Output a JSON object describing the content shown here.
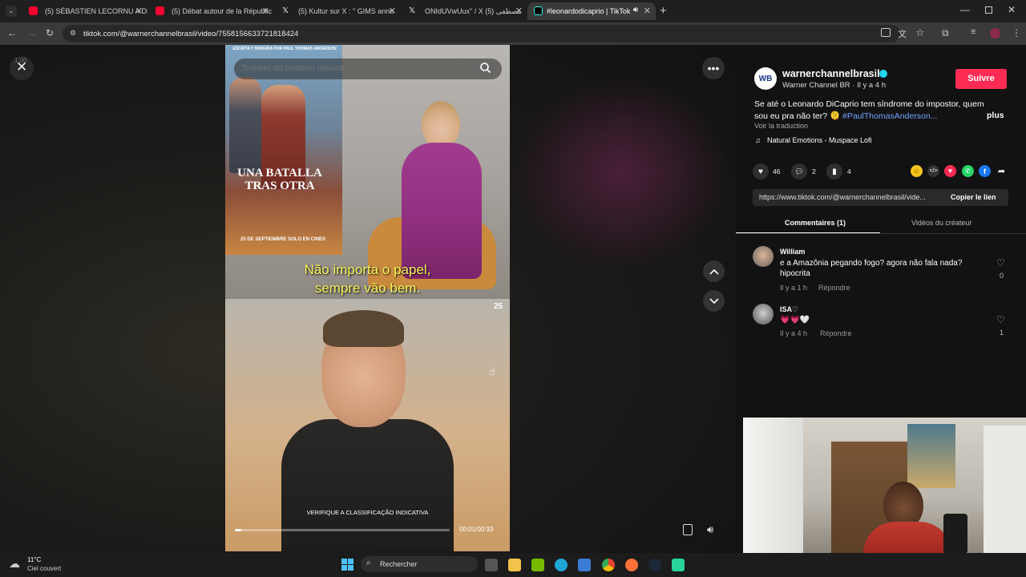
{
  "browser": {
    "tabs": [
      {
        "title": "(5) SÉBASTIEN LECORNU A DÉM",
        "favicon_color": "#ff0033"
      },
      {
        "title": "(5) Débat autour de la Républic",
        "favicon_color": "#ff0033"
      },
      {
        "title": "(5) Kultur sur X : \" GIMS anno",
        "favicon_color": "#ffffff"
      },
      {
        "title": "ONIdUVwUux\" / X مصطفى (5)",
        "favicon_color": "#ffffff"
      },
      {
        "title": "#leonardodicaprio | TikTok",
        "favicon_color": "#25f4ee"
      }
    ],
    "url": "tiktok.com/@warnerchannelbrasil/video/7558156633721818424"
  },
  "video": {
    "speed_label": "1.00",
    "search_placeholder": "Trouver du contenu associé",
    "poster_top_text": "ESCRITA Y DIRIGIDA POR PAUL THOMAS ANDERSON",
    "poster_title": "UNA BATALLA TRAS OTRA",
    "poster_date": "25 DE SEPTIEMBRE SOLO EN CINES",
    "subtitle_line1": "Não importa o papel,",
    "subtitle_line2": "sempre vão bem.",
    "rating_badge": "25",
    "rating_notice": "VERIFIQUE A CLASSIFICAÇÃO INDICATIVA",
    "time": "00:01/00:33",
    "progress": 0.03
  },
  "post": {
    "author": "warnerchannelbrasil",
    "subtitle": "Warner Channel BR · Il y a 4 h",
    "follow_label": "Suivre",
    "caption_line1": "Se até o Leonardo DiCaprio tem síndrome do impostor, quem",
    "caption_line2": "sou eu pra não ter? 🫠",
    "caption_tag": "#PaulThomasAnderson...",
    "more_label": "plus",
    "translate_label": "Voir la traduction",
    "music": "Natural Emotions - Muspace Lofi",
    "likes": "46",
    "comments_count": "2",
    "saves": "4",
    "link": "https://www.tiktok.com/@warnerchannelbrasil/vide...",
    "copy_link_label": "Copier le lien",
    "tab_comments": "Commentaires (1)",
    "tab_creator_videos": "Vidéos du créateur"
  },
  "comments": [
    {
      "user": "William",
      "text_line1": "e a Amazônia pegando fogo? agora não fala nada?",
      "text_line2": "hipocrita",
      "time": "Il y a 1 h",
      "reply": "Répondre",
      "likes": "0"
    },
    {
      "user": "ISA♡",
      "text_line1": "💗💗🤍",
      "text_line2": "",
      "time": "Il y a 4 h",
      "reply": "Répondre",
      "likes": "1"
    }
  ],
  "taskbar": {
    "temp": "11°C",
    "weather": "Ciel couvert",
    "search_label": "Rechercher"
  },
  "colors": {
    "accent": "#fe2c55",
    "link": "#6fa4ff",
    "subtitle": "#f7f35c"
  }
}
